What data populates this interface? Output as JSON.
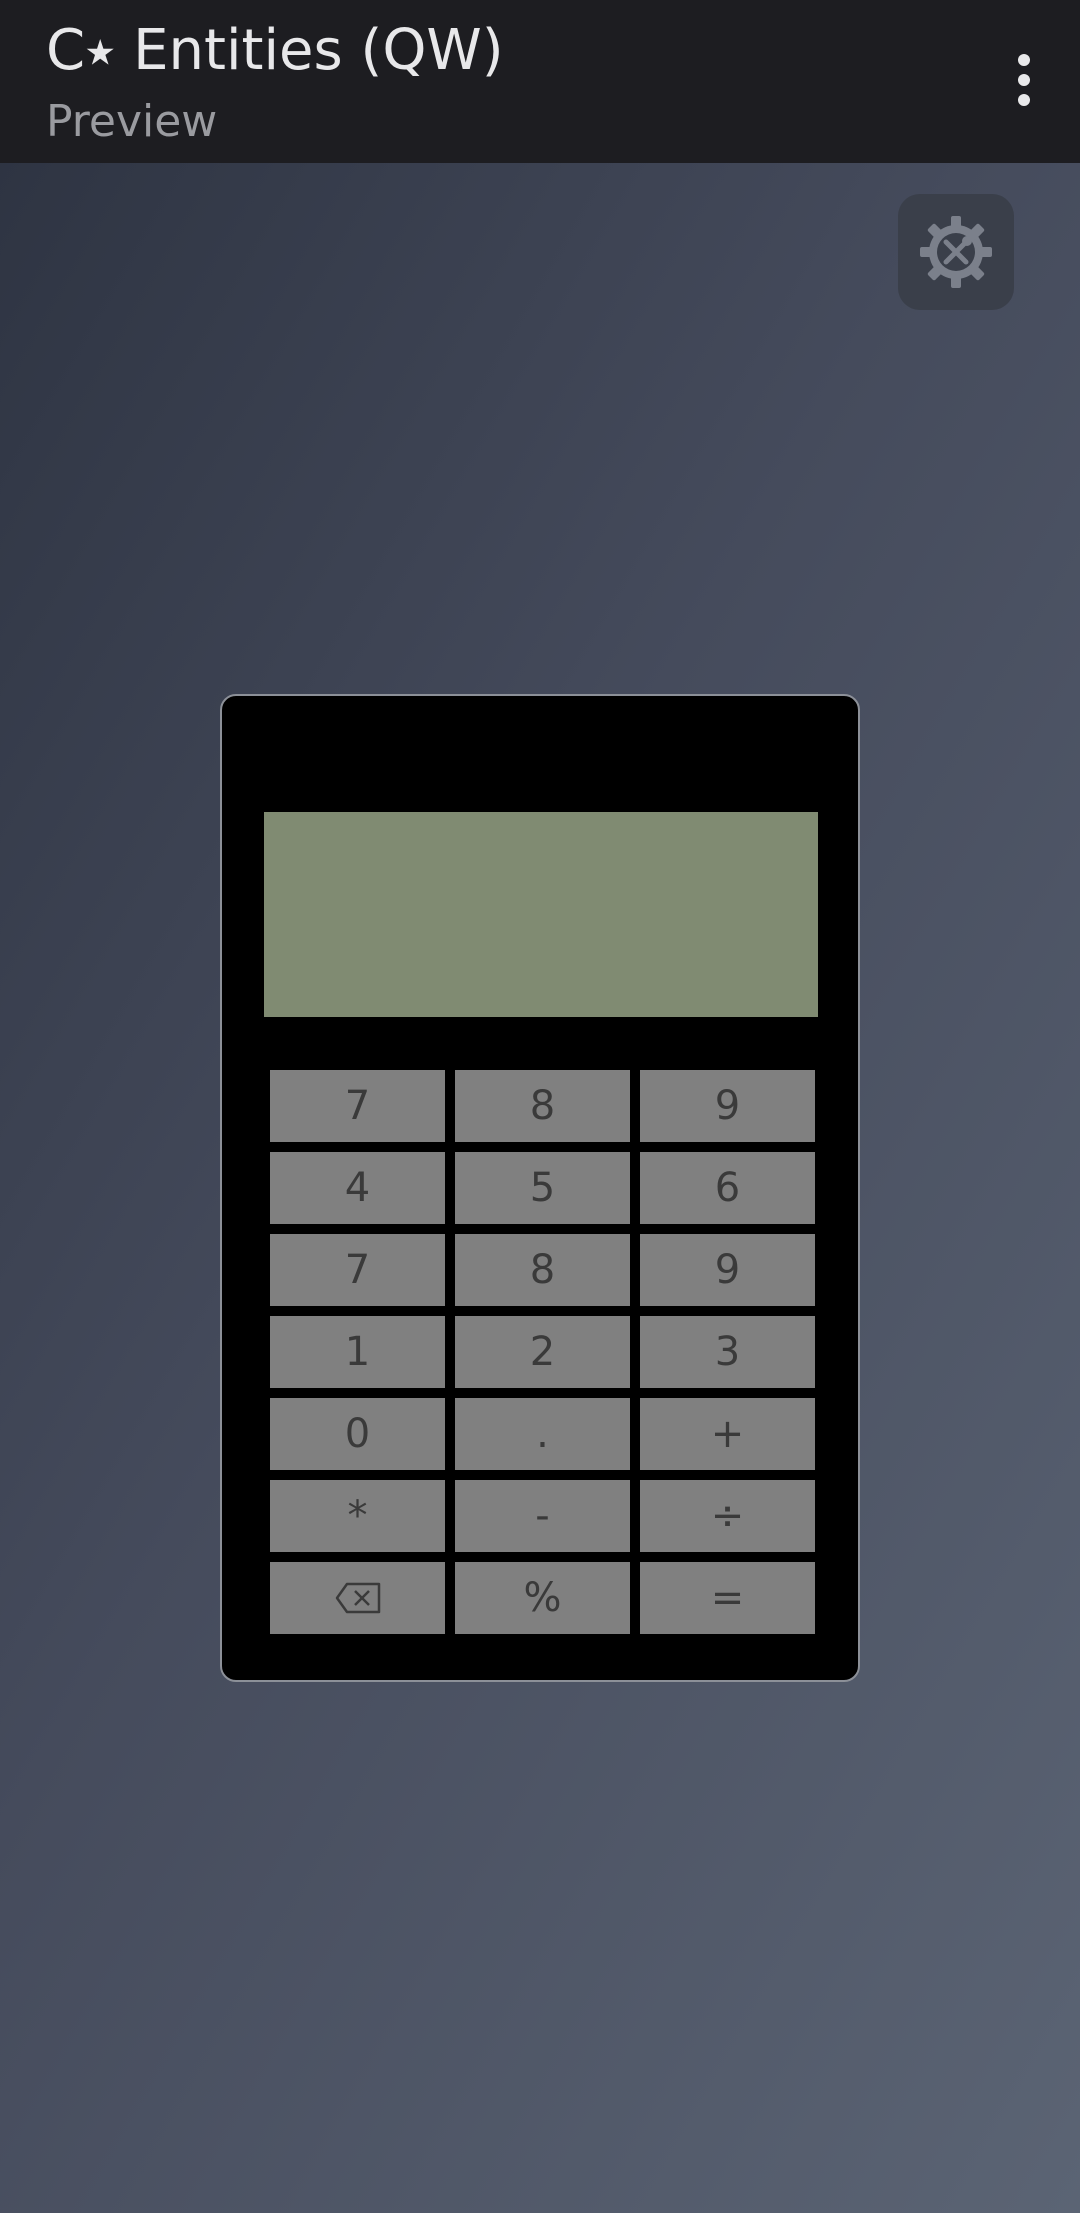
{
  "app_bar": {
    "title": "C⭑ Entities (QW)",
    "subtitle": "Preview",
    "overflow_icon": "more-vert-icon"
  },
  "toolbar": {
    "tools_icon": "settings-tools-icon"
  },
  "calculator": {
    "display_value": "",
    "display_color": "#808b72",
    "key_color": "#808080",
    "keys": [
      {
        "label": "7",
        "name": "key-7"
      },
      {
        "label": "8",
        "name": "key-8"
      },
      {
        "label": "9",
        "name": "key-9"
      },
      {
        "label": "4",
        "name": "key-4"
      },
      {
        "label": "5",
        "name": "key-5"
      },
      {
        "label": "6",
        "name": "key-6"
      },
      {
        "label": "7",
        "name": "key-7"
      },
      {
        "label": "8",
        "name": "key-8"
      },
      {
        "label": "9",
        "name": "key-9"
      },
      {
        "label": "1",
        "name": "key-1"
      },
      {
        "label": "2",
        "name": "key-2"
      },
      {
        "label": "3",
        "name": "key-3"
      },
      {
        "label": "0",
        "name": "key-0"
      },
      {
        "label": ".",
        "name": "key-decimal"
      },
      {
        "label": "+",
        "name": "key-plus"
      },
      {
        "label": "*",
        "name": "key-multiply"
      },
      {
        "label": "-",
        "name": "key-minus"
      },
      {
        "label": "÷",
        "name": "key-divide"
      },
      {
        "label": "",
        "name": "key-backspace",
        "icon": "backspace-icon"
      },
      {
        "label": "%",
        "name": "key-percent"
      },
      {
        "label": "=",
        "name": "key-equals"
      }
    ]
  }
}
